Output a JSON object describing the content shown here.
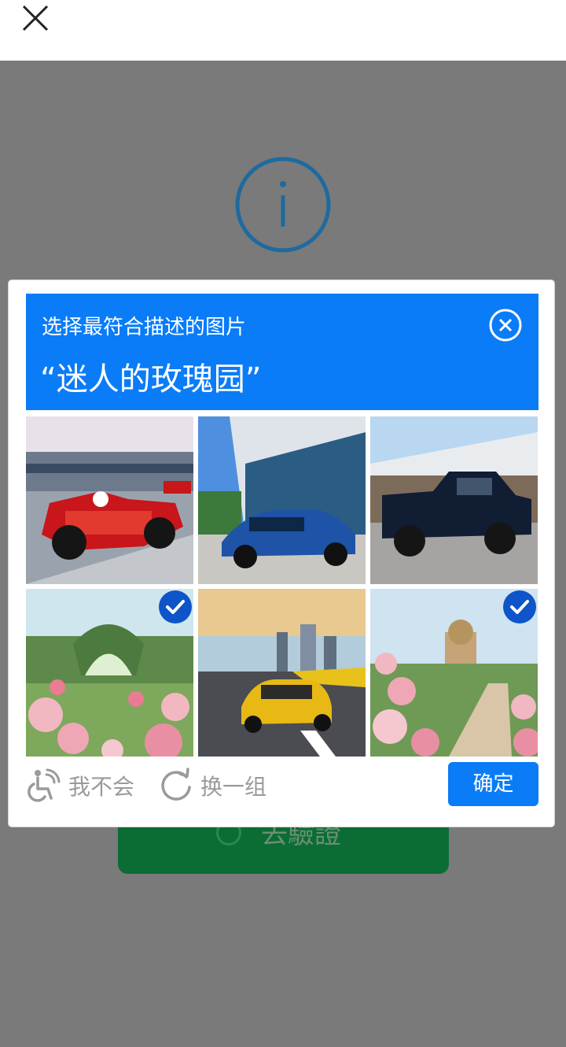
{
  "colors": {
    "accent": "#0a7cf8",
    "check": "#0d55c8",
    "verify_green": "#0b6c34",
    "overlay": "#7a7a7a",
    "info": "#1f6aa0"
  },
  "topbar": {
    "close_icon": "close-icon"
  },
  "background": {
    "info_icon": "info-icon",
    "verify_button_label": "去驗證"
  },
  "captcha": {
    "instruction": "选择最符合描述的图片",
    "target": "“迷人的玫瑰园”",
    "close_icon": "close-circle-icon",
    "tiles": [
      {
        "subject": "red race car",
        "selected": false
      },
      {
        "subject": "blue sedan",
        "selected": false
      },
      {
        "subject": "black pickup truck",
        "selected": false
      },
      {
        "subject": "rose garden",
        "selected": true
      },
      {
        "subject": "yellow taxi",
        "selected": false
      },
      {
        "subject": "rose garden with palace",
        "selected": true
      }
    ],
    "footer": {
      "accessibility_label": "我不会",
      "refresh_label": "换一组",
      "confirm_label": "确定"
    }
  }
}
